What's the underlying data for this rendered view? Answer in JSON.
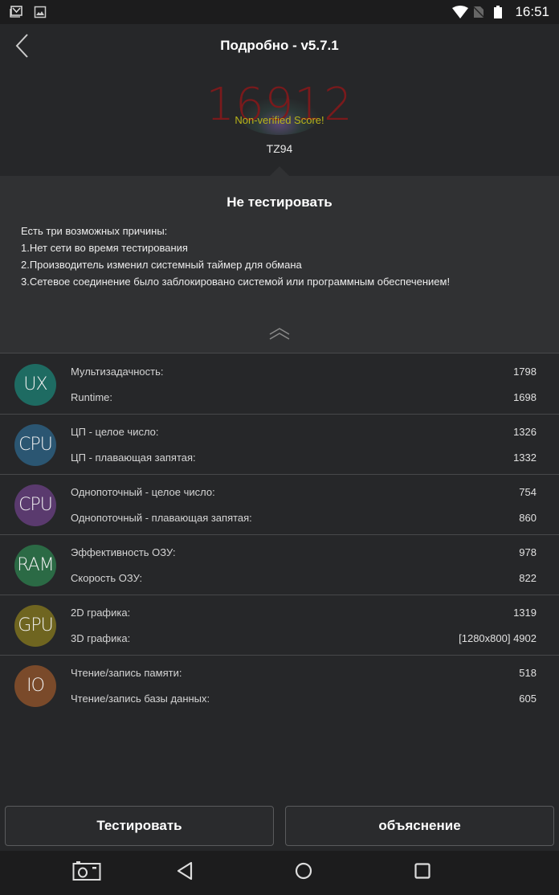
{
  "status_bar": {
    "time": "16:51",
    "left_icons": [
      "gmail-notification-icon",
      "image-notification-icon"
    ],
    "right_icons": [
      "wifi-icon",
      "no-sim-icon",
      "battery-icon"
    ]
  },
  "header": {
    "title": "Подробно - v5.7.1",
    "back_icon": "chevron-left-icon",
    "score": "16912",
    "score_note": "Non-verified Score!",
    "device": "TZ94"
  },
  "warning": {
    "title": "Не тестировать",
    "lines": [
      "Есть три возможных причины:",
      "1.Нет сети во время тестирования",
      "2.Производитель изменил системный таймер для обмана",
      "3.Сетевое соединение было заблокировано системой или программным обеспечением!"
    ],
    "collapse_icon": "double-chevron-up-icon"
  },
  "results": [
    {
      "badge": "UX",
      "color": "#1e6b62",
      "metrics": [
        {
          "label": "Мультизадачность:",
          "value": "1798"
        },
        {
          "label": "Runtime:",
          "value": "1698"
        }
      ]
    },
    {
      "badge": "CPU",
      "color": "#2b5672",
      "metrics": [
        {
          "label": "ЦП - целое число:",
          "value": "1326"
        },
        {
          "label": "ЦП - плавающая запятая:",
          "value": "1332"
        }
      ]
    },
    {
      "badge": "CPU",
      "color": "#5a3a6e",
      "metrics": [
        {
          "label": "Однопоточный - целое число:",
          "value": "754"
        },
        {
          "label": "Однопоточный - плавающая запятая:",
          "value": "860"
        }
      ]
    },
    {
      "badge": "RAM",
      "color": "#2b6a45",
      "metrics": [
        {
          "label": "Эффективность ОЗУ:",
          "value": "978"
        },
        {
          "label": "Скорость ОЗУ:",
          "value": "822"
        }
      ]
    },
    {
      "badge": "GPU",
      "color": "#6f6520",
      "metrics": [
        {
          "label": "2D графика:",
          "value": "1319"
        },
        {
          "label": "3D графика:",
          "value": "[1280x800] 4902"
        }
      ]
    },
    {
      "badge": "IO",
      "color": "#7a4a2a",
      "metrics": [
        {
          "label": "Чтение/запись памяти:",
          "value": "518"
        },
        {
          "label": "Чтение/запись базы данных:",
          "value": "605"
        }
      ]
    }
  ],
  "buttons": {
    "test": "Тестировать",
    "explain": "объяснение"
  },
  "nav_bar": {
    "items": [
      "screenshot-icon",
      "back-triangle-icon",
      "home-circle-icon",
      "recents-square-icon"
    ]
  }
}
